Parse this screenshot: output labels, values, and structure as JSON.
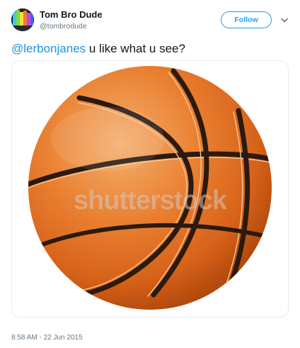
{
  "author": {
    "display_name": "Tom Bro Dude",
    "handle": "@tombrodude"
  },
  "header": {
    "follow_label": "Follow"
  },
  "tweet": {
    "mention": "@lerbonjanes",
    "text": " u like what u see?",
    "timestamp": "8:58 AM - 22 Jun 2015"
  },
  "media": {
    "watermark": "shutterstock",
    "colors": {
      "ball_light": "#f5a461",
      "ball_mid": "#e8731f",
      "ball_dark": "#b9470a",
      "seam": "#2b1a10"
    }
  },
  "colors": {
    "accent": "#1da1f2",
    "mention": "#1b95e0",
    "secondary_text": "#657786"
  }
}
